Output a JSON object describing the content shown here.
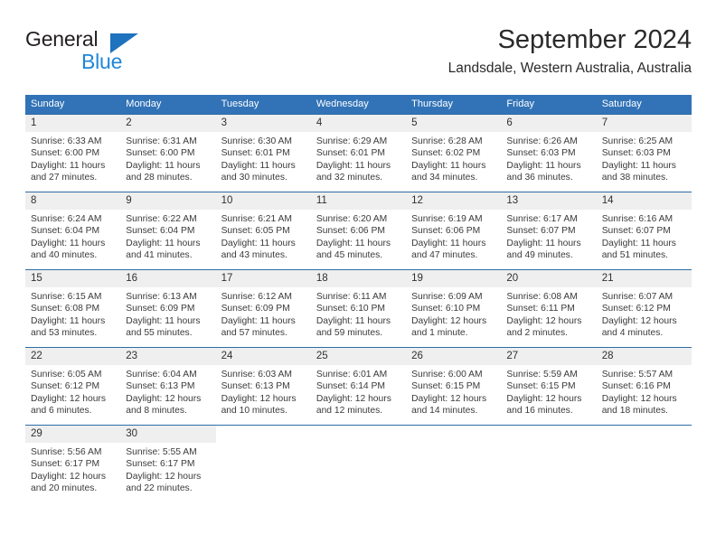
{
  "brand": {
    "name_top": "General",
    "name_bottom": "Blue",
    "accent_color": "#1f72bd",
    "blue_text_color": "#1f86d8"
  },
  "header": {
    "title": "September 2024",
    "subtitle": "Landsdale, Western Australia, Australia"
  },
  "calendar": {
    "header_bg": "#3273b7",
    "header_text_color": "#ffffff",
    "daynum_bg": "#efefef",
    "row_divider_color": "#2e6da4",
    "weekday_headers": [
      "Sunday",
      "Monday",
      "Tuesday",
      "Wednesday",
      "Thursday",
      "Friday",
      "Saturday"
    ],
    "weeks": [
      [
        {
          "day": "1",
          "sunrise": "Sunrise: 6:33 AM",
          "sunset": "Sunset: 6:00 PM",
          "daylight": "Daylight: 11 hours and 27 minutes."
        },
        {
          "day": "2",
          "sunrise": "Sunrise: 6:31 AM",
          "sunset": "Sunset: 6:00 PM",
          "daylight": "Daylight: 11 hours and 28 minutes."
        },
        {
          "day": "3",
          "sunrise": "Sunrise: 6:30 AM",
          "sunset": "Sunset: 6:01 PM",
          "daylight": "Daylight: 11 hours and 30 minutes."
        },
        {
          "day": "4",
          "sunrise": "Sunrise: 6:29 AM",
          "sunset": "Sunset: 6:01 PM",
          "daylight": "Daylight: 11 hours and 32 minutes."
        },
        {
          "day": "5",
          "sunrise": "Sunrise: 6:28 AM",
          "sunset": "Sunset: 6:02 PM",
          "daylight": "Daylight: 11 hours and 34 minutes."
        },
        {
          "day": "6",
          "sunrise": "Sunrise: 6:26 AM",
          "sunset": "Sunset: 6:03 PM",
          "daylight": "Daylight: 11 hours and 36 minutes."
        },
        {
          "day": "7",
          "sunrise": "Sunrise: 6:25 AM",
          "sunset": "Sunset: 6:03 PM",
          "daylight": "Daylight: 11 hours and 38 minutes."
        }
      ],
      [
        {
          "day": "8",
          "sunrise": "Sunrise: 6:24 AM",
          "sunset": "Sunset: 6:04 PM",
          "daylight": "Daylight: 11 hours and 40 minutes."
        },
        {
          "day": "9",
          "sunrise": "Sunrise: 6:22 AM",
          "sunset": "Sunset: 6:04 PM",
          "daylight": "Daylight: 11 hours and 41 minutes."
        },
        {
          "day": "10",
          "sunrise": "Sunrise: 6:21 AM",
          "sunset": "Sunset: 6:05 PM",
          "daylight": "Daylight: 11 hours and 43 minutes."
        },
        {
          "day": "11",
          "sunrise": "Sunrise: 6:20 AM",
          "sunset": "Sunset: 6:06 PM",
          "daylight": "Daylight: 11 hours and 45 minutes."
        },
        {
          "day": "12",
          "sunrise": "Sunrise: 6:19 AM",
          "sunset": "Sunset: 6:06 PM",
          "daylight": "Daylight: 11 hours and 47 minutes."
        },
        {
          "day": "13",
          "sunrise": "Sunrise: 6:17 AM",
          "sunset": "Sunset: 6:07 PM",
          "daylight": "Daylight: 11 hours and 49 minutes."
        },
        {
          "day": "14",
          "sunrise": "Sunrise: 6:16 AM",
          "sunset": "Sunset: 6:07 PM",
          "daylight": "Daylight: 11 hours and 51 minutes."
        }
      ],
      [
        {
          "day": "15",
          "sunrise": "Sunrise: 6:15 AM",
          "sunset": "Sunset: 6:08 PM",
          "daylight": "Daylight: 11 hours and 53 minutes."
        },
        {
          "day": "16",
          "sunrise": "Sunrise: 6:13 AM",
          "sunset": "Sunset: 6:09 PM",
          "daylight": "Daylight: 11 hours and 55 minutes."
        },
        {
          "day": "17",
          "sunrise": "Sunrise: 6:12 AM",
          "sunset": "Sunset: 6:09 PM",
          "daylight": "Daylight: 11 hours and 57 minutes."
        },
        {
          "day": "18",
          "sunrise": "Sunrise: 6:11 AM",
          "sunset": "Sunset: 6:10 PM",
          "daylight": "Daylight: 11 hours and 59 minutes."
        },
        {
          "day": "19",
          "sunrise": "Sunrise: 6:09 AM",
          "sunset": "Sunset: 6:10 PM",
          "daylight": "Daylight: 12 hours and 1 minute."
        },
        {
          "day": "20",
          "sunrise": "Sunrise: 6:08 AM",
          "sunset": "Sunset: 6:11 PM",
          "daylight": "Daylight: 12 hours and 2 minutes."
        },
        {
          "day": "21",
          "sunrise": "Sunrise: 6:07 AM",
          "sunset": "Sunset: 6:12 PM",
          "daylight": "Daylight: 12 hours and 4 minutes."
        }
      ],
      [
        {
          "day": "22",
          "sunrise": "Sunrise: 6:05 AM",
          "sunset": "Sunset: 6:12 PM",
          "daylight": "Daylight: 12 hours and 6 minutes."
        },
        {
          "day": "23",
          "sunrise": "Sunrise: 6:04 AM",
          "sunset": "Sunset: 6:13 PM",
          "daylight": "Daylight: 12 hours and 8 minutes."
        },
        {
          "day": "24",
          "sunrise": "Sunrise: 6:03 AM",
          "sunset": "Sunset: 6:13 PM",
          "daylight": "Daylight: 12 hours and 10 minutes."
        },
        {
          "day": "25",
          "sunrise": "Sunrise: 6:01 AM",
          "sunset": "Sunset: 6:14 PM",
          "daylight": "Daylight: 12 hours and 12 minutes."
        },
        {
          "day": "26",
          "sunrise": "Sunrise: 6:00 AM",
          "sunset": "Sunset: 6:15 PM",
          "daylight": "Daylight: 12 hours and 14 minutes."
        },
        {
          "day": "27",
          "sunrise": "Sunrise: 5:59 AM",
          "sunset": "Sunset: 6:15 PM",
          "daylight": "Daylight: 12 hours and 16 minutes."
        },
        {
          "day": "28",
          "sunrise": "Sunrise: 5:57 AM",
          "sunset": "Sunset: 6:16 PM",
          "daylight": "Daylight: 12 hours and 18 minutes."
        }
      ],
      [
        {
          "day": "29",
          "sunrise": "Sunrise: 5:56 AM",
          "sunset": "Sunset: 6:17 PM",
          "daylight": "Daylight: 12 hours and 20 minutes."
        },
        {
          "day": "30",
          "sunrise": "Sunrise: 5:55 AM",
          "sunset": "Sunset: 6:17 PM",
          "daylight": "Daylight: 12 hours and 22 minutes."
        },
        {
          "day": "",
          "sunrise": "",
          "sunset": "",
          "daylight": ""
        },
        {
          "day": "",
          "sunrise": "",
          "sunset": "",
          "daylight": ""
        },
        {
          "day": "",
          "sunrise": "",
          "sunset": "",
          "daylight": ""
        },
        {
          "day": "",
          "sunrise": "",
          "sunset": "",
          "daylight": ""
        },
        {
          "day": "",
          "sunrise": "",
          "sunset": "",
          "daylight": ""
        }
      ]
    ]
  }
}
